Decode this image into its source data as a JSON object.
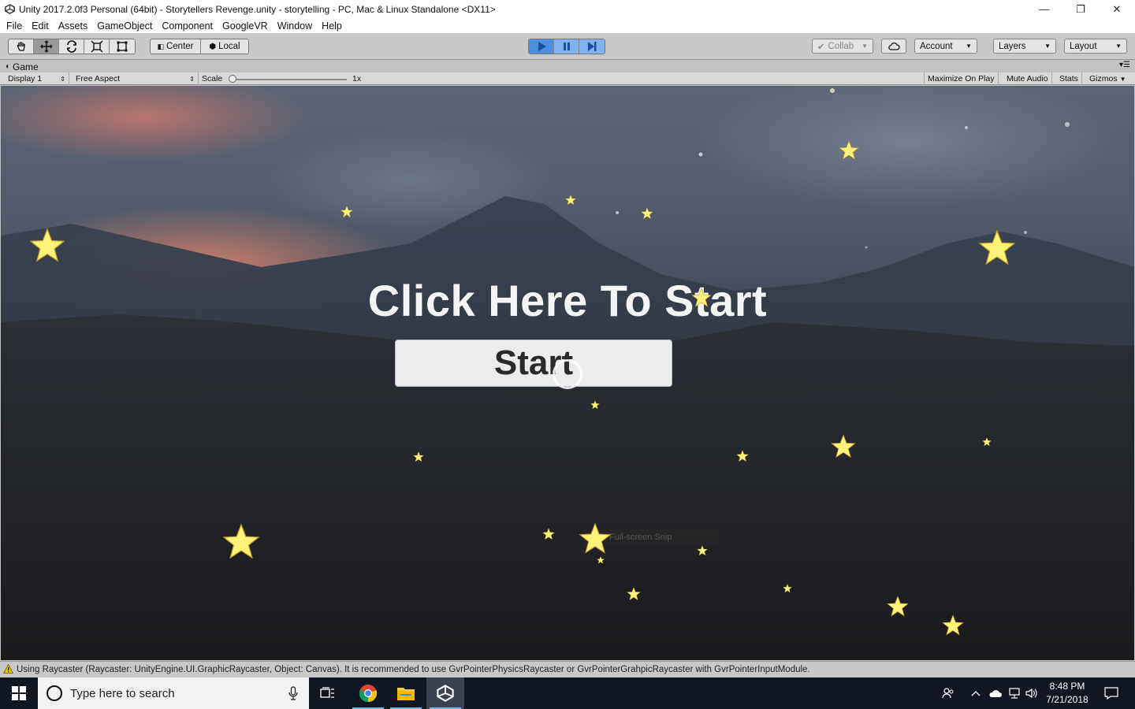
{
  "window": {
    "title": "Unity 2017.2.0f3 Personal (64bit) - Storytellers Revenge.unity - storytelling - PC, Mac & Linux Standalone <DX11>",
    "minimize_glyph": "—",
    "maximize_glyph": "❐",
    "close_glyph": "✕"
  },
  "menu": [
    "File",
    "Edit",
    "Assets",
    "GameObject",
    "Component",
    "GoogleVR",
    "Window",
    "Help"
  ],
  "toolbar": {
    "pivot_center": "Center",
    "pivot_local": "Local",
    "collab": "Collab",
    "account": "Account",
    "layers": "Layers",
    "layout": "Layout"
  },
  "game_panel": {
    "tab_label": "Game",
    "display": "Display 1",
    "aspect": "Free Aspect",
    "scale_label": "Scale",
    "scale_value": "1x",
    "maximize_on_play": "Maximize On Play",
    "mute_audio": "Mute Audio",
    "stats": "Stats",
    "gizmos": "Gizmos"
  },
  "game": {
    "headline": "Click Here To Start",
    "start_button": "Start",
    "snip_tooltip": "Full-screen Snip",
    "star_color": "#fff27a"
  },
  "status": {
    "message": "Using Raycaster (Raycaster: UnityEngine.UI.GraphicRaycaster, Object: Canvas). It is recommended to use GvrPointerPhysicsRaycaster or GvrPointerGrahpicRaycaster with GvrPointerInputModule."
  },
  "taskbar": {
    "search_placeholder": "Type here to search",
    "time": "8:48 PM",
    "date": "7/21/2018"
  },
  "colors": {
    "play_blue": "#4a8fe0",
    "taskbar": "#101723",
    "unity_gray": "#c2c2c2"
  }
}
